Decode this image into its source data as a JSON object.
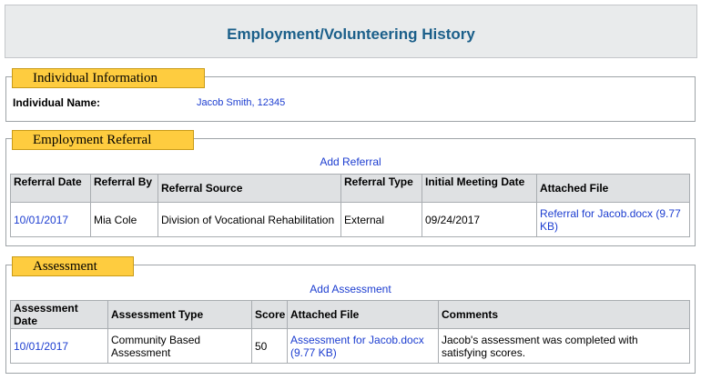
{
  "page": {
    "title": "Employment/Volunteering History"
  },
  "individual_section": {
    "heading": "Individual Information",
    "name_label": "Individual Name:",
    "name_value": "Jacob Smith, 12345"
  },
  "referral_section": {
    "heading": "Employment Referral",
    "add_link": "Add Referral",
    "columns": [
      "Referral Date",
      "Referral By",
      "Referral Source",
      "Referral Type",
      "Initial Meeting Date",
      "Attached File"
    ],
    "rows": [
      {
        "date": "10/01/2017",
        "by": "Mia Cole",
        "source": "Division of Vocational Rehabilitation",
        "type": "External",
        "initial_meeting": "09/24/2017",
        "file": "Referral for Jacob.docx  (9.77 KB)"
      }
    ]
  },
  "assessment_section": {
    "heading": "Assessment",
    "add_link": "Add Assessment",
    "columns": [
      "Assessment Date",
      "Assessment Type",
      "Score",
      "Attached File",
      "Comments"
    ],
    "rows": [
      {
        "date": "10/01/2017",
        "type": "Community Based Assessment",
        "score": "50",
        "file": "Assessment for Jacob.docx (9.77 KB)",
        "comments": "Jacob's assessment was completed with satisfying scores."
      }
    ]
  },
  "colors": {
    "header_bg": "#e9ebec",
    "title_text": "#1b5f8a",
    "tab_bg": "#fecc3f",
    "link": "#1c3dd0",
    "table_header_bg": "#dfe1e3"
  }
}
